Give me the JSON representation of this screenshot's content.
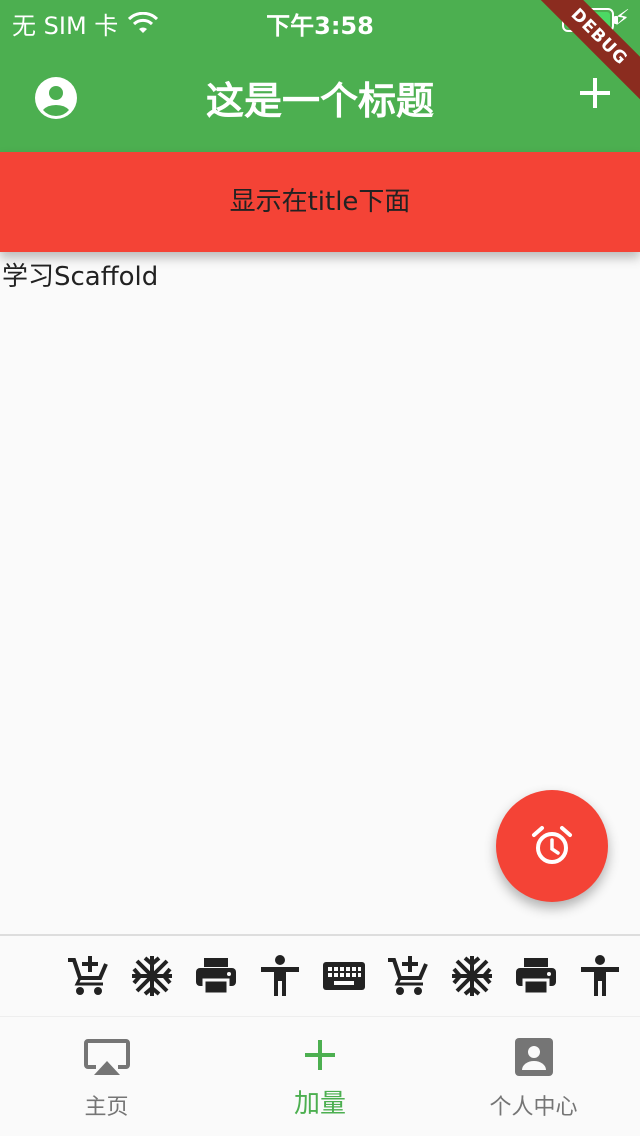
{
  "status_bar": {
    "carrier": "无 SIM 卡",
    "time": "下午3:58"
  },
  "debug_banner": "DEBUG",
  "app_bar": {
    "title": "这是一个标题",
    "leading_icon": "account-circle-icon",
    "action_icon": "add-icon",
    "background": "#4caf50"
  },
  "app_bar_bottom": {
    "text": "显示在title下面",
    "background": "#f44336"
  },
  "body": {
    "text": "学习Scaffold"
  },
  "fab": {
    "icon": "alarm-icon",
    "background": "#f44336"
  },
  "persistent_footer_icons": [
    "add-shopping-cart-icon",
    "ac-unit-icon",
    "print-icon",
    "accessibility-icon",
    "keyboard-icon",
    "add-shopping-cart-icon",
    "ac-unit-icon",
    "print-icon",
    "accessibility-icon"
  ],
  "bottom_nav": {
    "active_color": "#4caf50",
    "items": [
      {
        "label": "主页",
        "icon": "airplay-icon",
        "active": false
      },
      {
        "label": "加量",
        "icon": "add-icon",
        "active": true
      },
      {
        "label": "个人中心",
        "icon": "account-box-icon",
        "active": false
      }
    ]
  }
}
